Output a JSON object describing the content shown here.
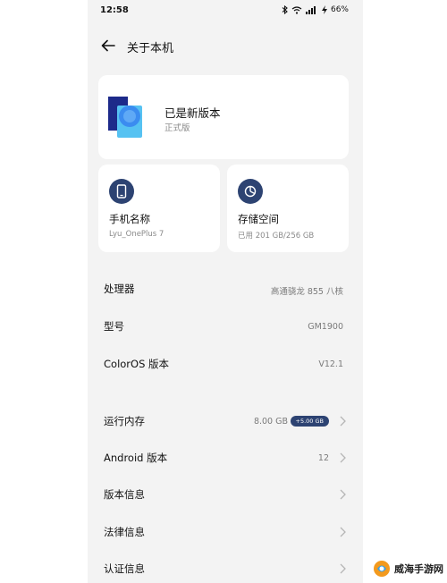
{
  "status_bar": {
    "time": "12:58",
    "battery": "66%"
  },
  "header": {
    "title": "关于本机"
  },
  "version": {
    "title": "已是新版本",
    "subtitle": "正式版"
  },
  "device_card": {
    "title": "手机名称",
    "subtitle": "Lyu_OnePlus 7",
    "icon": "phone-icon"
  },
  "storage_card": {
    "title": "存储空间",
    "subtitle": "已用 201 GB/256 GB",
    "icon": "pie-chart-icon"
  },
  "specs": [
    {
      "label": "处理器",
      "value": "高通骁龙 855 八核"
    },
    {
      "label": "型号",
      "value": "GM1900"
    },
    {
      "label": "ColorOS 版本",
      "value": "V12.1"
    }
  ],
  "settings": [
    {
      "label": "运行内存",
      "value": "8.00 GB",
      "badge": "+5.00 GB"
    },
    {
      "label": "Android 版本",
      "value": "12"
    },
    {
      "label": "版本信息",
      "value": ""
    },
    {
      "label": "法律信息",
      "value": ""
    },
    {
      "label": "认证信息",
      "value": ""
    }
  ],
  "colors": {
    "accent": "#2d4372",
    "background": "#f3f3f3"
  },
  "watermark": {
    "text": "威海手游网"
  }
}
